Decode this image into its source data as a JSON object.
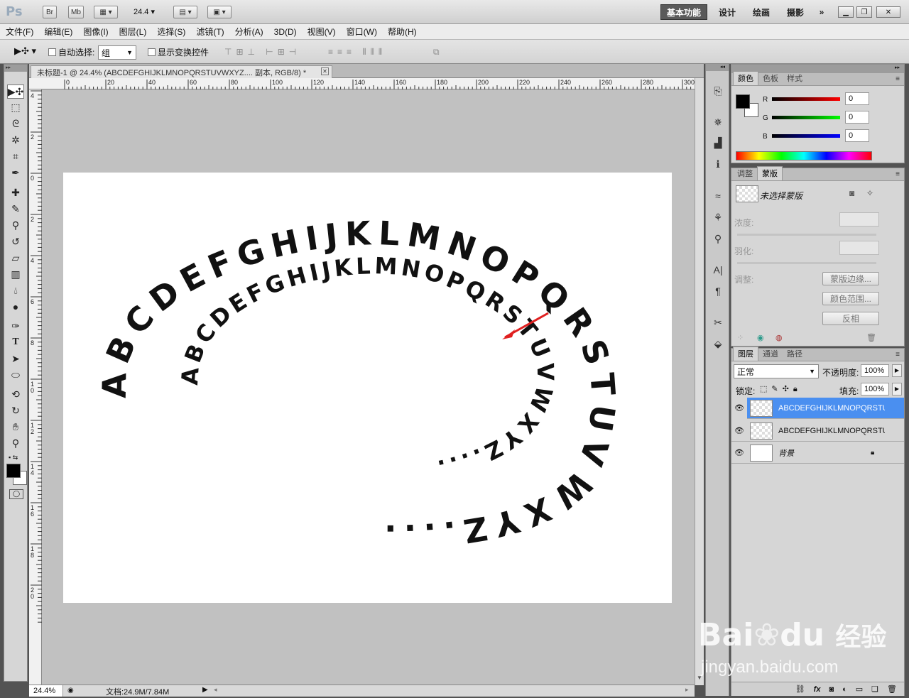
{
  "app": {
    "logo": "Ps",
    "bridge_btn": "Br",
    "minibridge_btn": "Mb",
    "zoom_value": "24.4",
    "workspaces": [
      "基本功能",
      "设计",
      "绘画",
      "摄影"
    ],
    "overflow": "»"
  },
  "menu": [
    "文件(F)",
    "编辑(E)",
    "图像(I)",
    "图层(L)",
    "选择(S)",
    "滤镜(T)",
    "分析(A)",
    "3D(D)",
    "视图(V)",
    "窗口(W)",
    "帮助(H)"
  ],
  "options": {
    "auto_select_label": "自动选择:",
    "auto_select_value": "组",
    "show_transform_label": "显示变换控件"
  },
  "document": {
    "tab_title": "未标题-1 @ 24.4% (ABCDEFGHIJKLMNOPQRSTUVWXYZ.... 副本, RGB/8) *",
    "h_ruler": [
      "0",
      "20",
      "40",
      "60",
      "80",
      "100",
      "120",
      "140",
      "160",
      "180",
      "200",
      "220",
      "240",
      "260",
      "280",
      "300"
    ],
    "v_ruler": [
      "4",
      "2",
      "0",
      "2",
      "4",
      "6",
      "8",
      "10",
      "12",
      "14",
      "16",
      "18",
      "20"
    ],
    "status_zoom": "24.4%",
    "status_doc": "文档:24.9M/7.84M",
    "outer_text": "ABCDEFGHIJKLMNOPQRSTUVWXYZ....",
    "inner_text": "ABCDEFGHIJKLMNOPQRSTUVWXYZ...."
  },
  "color_panel": {
    "tabs": [
      "颜色",
      "色板",
      "样式"
    ],
    "r_label": "R",
    "g_label": "G",
    "b_label": "B",
    "r_value": "0",
    "g_value": "0",
    "b_value": "0",
    "fg": "#000000",
    "bg": "#ffffff"
  },
  "mask_panel": {
    "tabs": [
      "调整",
      "蒙版"
    ],
    "title": "未选择蒙版",
    "density_label": "浓度:",
    "feather_label": "羽化:",
    "adjust_label": "调整:",
    "btn_mask_edge": "蒙版边缘...",
    "btn_color_range": "颜色范围...",
    "btn_invert": "反相"
  },
  "layers_panel": {
    "tabs": [
      "图层",
      "通道",
      "路径"
    ],
    "blend_mode": "正常",
    "opacity_label": "不透明度:",
    "opacity_value": "100%",
    "lock_label": "锁定:",
    "fill_label": "填充:",
    "fill_value": "100%",
    "layers": [
      {
        "name": "ABCDEFGHIJKLMNOPQRSTU...",
        "selected": true
      },
      {
        "name": "ABCDEFGHIJKLMNOPQRSTU...",
        "selected": false
      },
      {
        "name": "背景",
        "selected": false
      }
    ],
    "footer_fx": "fx"
  },
  "watermark": {
    "brand": "Bai",
    "brand2": "du",
    "cn": "经验",
    "url": "jingyan.baidu.com"
  },
  "colors": {
    "accent_selected": "#4a8ff0",
    "annotation_arrow": "#e02020"
  }
}
